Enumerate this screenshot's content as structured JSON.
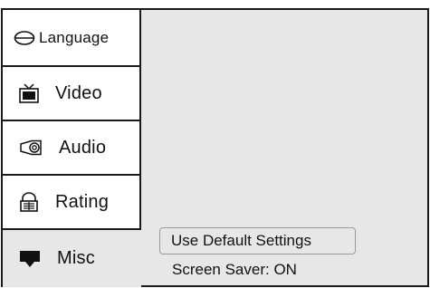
{
  "menu": {
    "tabs": [
      {
        "id": "language",
        "label": "Language",
        "icon": "language-icon"
      },
      {
        "id": "video",
        "label": "Video",
        "icon": "tv-icon"
      },
      {
        "id": "audio",
        "label": "Audio",
        "icon": "speaker-icon"
      },
      {
        "id": "rating",
        "label": "Rating",
        "icon": "rating-lock-icon"
      },
      {
        "id": "misc",
        "label": "Misc",
        "icon": "monitor-icon",
        "selected": true
      }
    ]
  },
  "options": {
    "use_default": "Use Default Settings",
    "screen_saver": "Screen Saver: ON"
  },
  "colors": {
    "panel_bg": "#e7e7e7",
    "tab_bg": "#ffffff",
    "border": "#1a1a1a"
  }
}
